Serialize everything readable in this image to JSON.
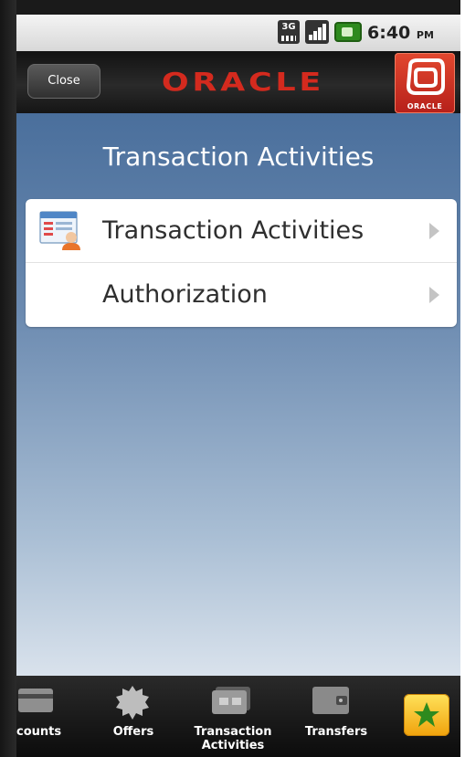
{
  "status_bar": {
    "network_label": "3G",
    "time": "6:40",
    "ampm": "PM"
  },
  "header": {
    "close_label": "Close",
    "logo_text": "ORACLE",
    "app_icon_text": "ORACLE"
  },
  "page": {
    "title": "Transaction Activities"
  },
  "menu": {
    "items": [
      {
        "label": "Transaction Activities",
        "icon": "user-list-icon"
      },
      {
        "label": "Authorization",
        "icon": ""
      }
    ]
  },
  "tabbar": {
    "tabs": [
      {
        "label": "counts",
        "icon": "card-icon"
      },
      {
        "label": "Offers",
        "icon": "gear-badge-icon"
      },
      {
        "label": "Transaction Activities",
        "icon": "cards-icon"
      },
      {
        "label": "Transfers",
        "icon": "wallet-icon"
      }
    ],
    "favorites_icon": "star-icon",
    "colors": {
      "favorites_bg": "#f7c326",
      "star": "#2e8a1e"
    }
  },
  "colors": {
    "brand_red": "#d42a1e",
    "header_bg": "#1c1c1c",
    "main_bg_top": "#4a6f9c",
    "main_bg_bottom": "#d9e2ec"
  }
}
